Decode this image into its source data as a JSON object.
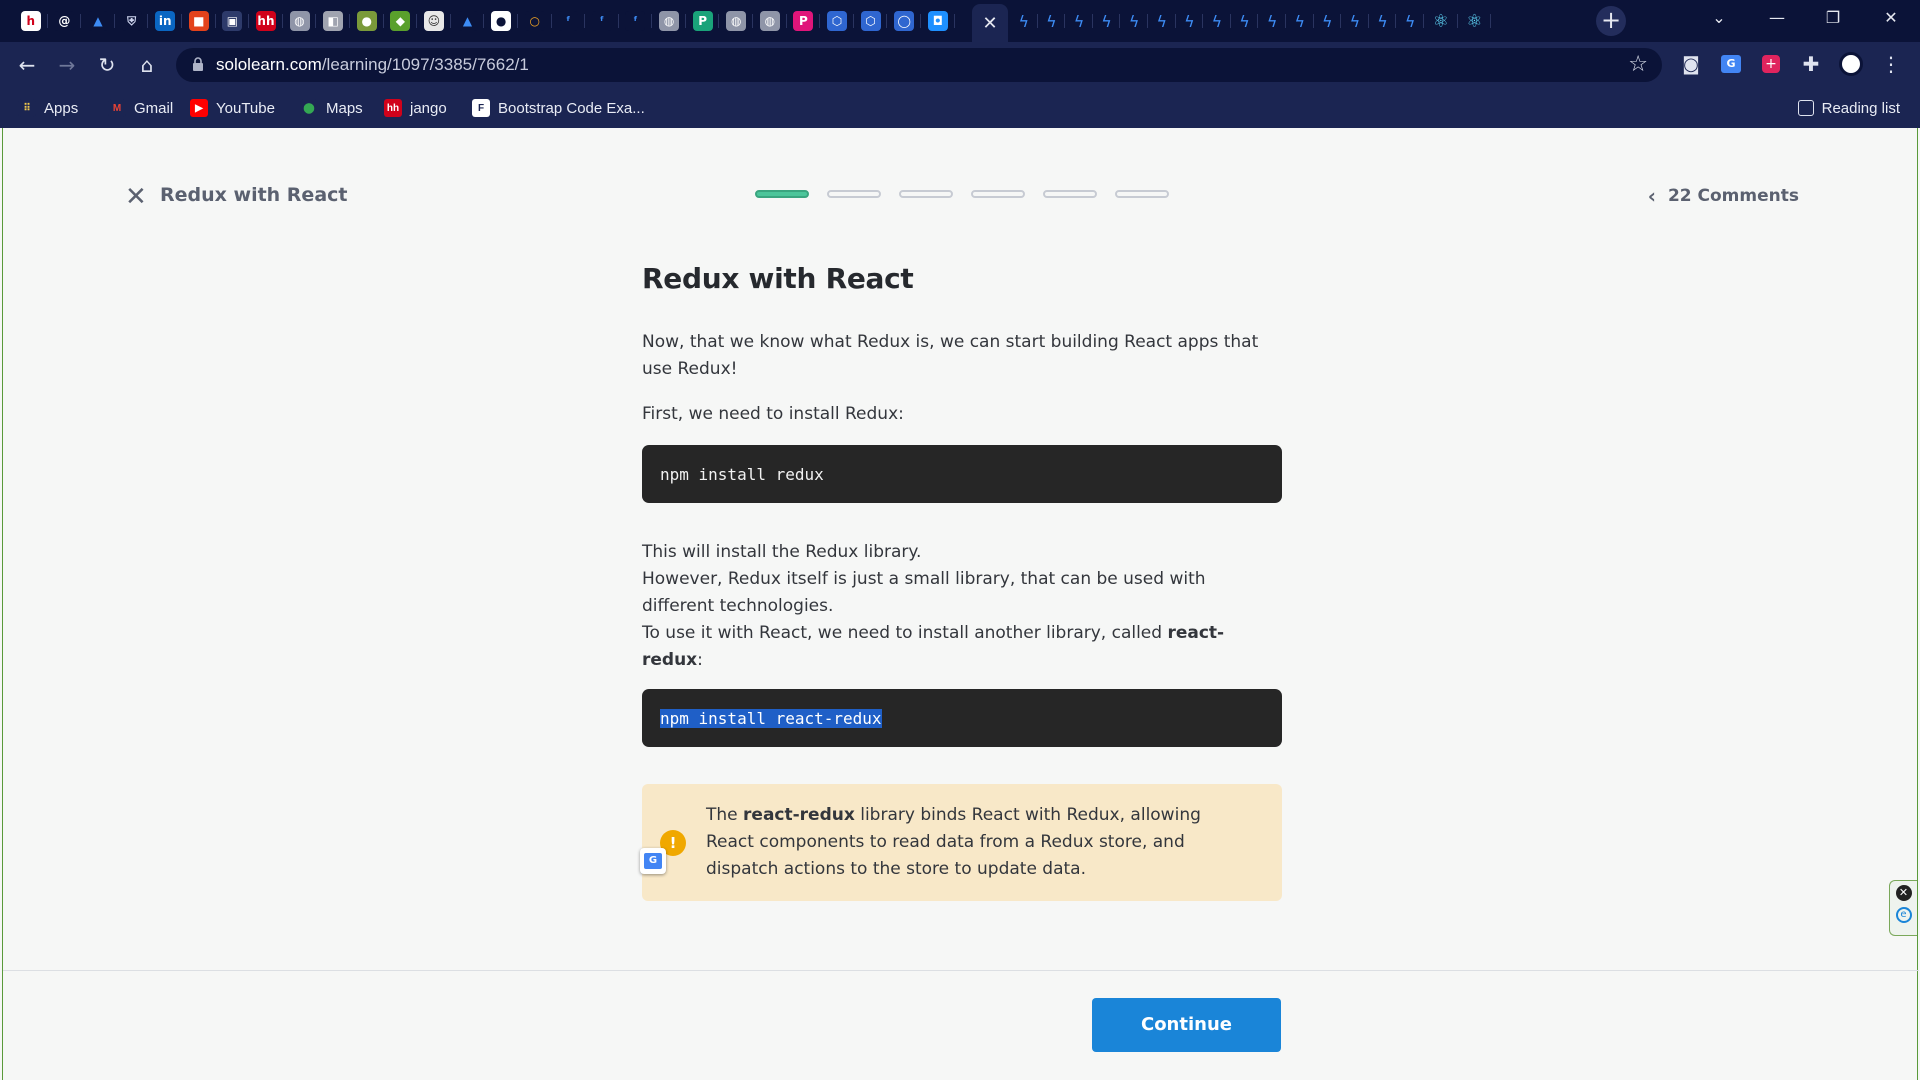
{
  "browser": {
    "tabs_left": [
      {
        "icon": "hh-icon",
        "bg": "#ffffff",
        "fg": "#d0021b",
        "txt": "h"
      },
      {
        "icon": "at-icon",
        "bg": "#0b1338",
        "fg": "#ffffff",
        "txt": "@"
      },
      {
        "icon": "triangle-icon",
        "bg": "#0b1338",
        "fg": "#3d8cf5",
        "txt": "▲"
      },
      {
        "icon": "shield-icon",
        "bg": "#0b1338",
        "fg": "#cfd6f0",
        "txt": "⛨"
      },
      {
        "icon": "linkedin-icon",
        "bg": "#0a66c2",
        "fg": "#ffffff",
        "txt": "in"
      },
      {
        "icon": "office-icon",
        "bg": "#e3421b",
        "fg": "#ffffff",
        "txt": "■"
      },
      {
        "icon": "monitor-icon",
        "bg": "#2d3a6a",
        "fg": "#ffffff",
        "txt": "▣"
      },
      {
        "icon": "hh-red-icon",
        "bg": "#d0021b",
        "fg": "#ffffff",
        "txt": "hh"
      },
      {
        "icon": "globe-icon",
        "bg": "#8f95a8",
        "fg": "#ffffff",
        "txt": "◍"
      },
      {
        "icon": "gray-doc-icon",
        "bg": "#a0a4b0",
        "fg": "#ffffff",
        "txt": "◧"
      },
      {
        "icon": "green-ball-icon",
        "bg": "#7a9a3a",
        "fg": "#ffffff",
        "txt": "●"
      },
      {
        "icon": "cube-icon",
        "bg": "#5aa02c",
        "fg": "#ffffff",
        "txt": "◆"
      },
      {
        "icon": "avatar-tab-icon",
        "bg": "#e8e8e8",
        "fg": "#333333",
        "txt": "☺"
      },
      {
        "icon": "atlassian-icon",
        "bg": "#0b1338",
        "fg": "#3d8cf5",
        "txt": "▲"
      },
      {
        "icon": "github-icon",
        "bg": "#ffffff",
        "fg": "#0b1338",
        "txt": "●"
      },
      {
        "icon": "ring-icon",
        "bg": "#0b1338",
        "fg": "#f5a623",
        "txt": "○"
      },
      {
        "icon": "bolt-tab-icon",
        "bg": "#0b1338",
        "fg": "#3d8cf5",
        "txt": "ᶠ"
      },
      {
        "icon": "bolt-tab-icon",
        "bg": "#0b1338",
        "fg": "#3d8cf5",
        "txt": "ᶠ"
      },
      {
        "icon": "bolt-tab-icon",
        "bg": "#0b1338",
        "fg": "#3d8cf5",
        "txt": "ᶠ"
      },
      {
        "icon": "globe-icon",
        "bg": "#8f95a8",
        "fg": "#ffffff",
        "txt": "◍"
      },
      {
        "icon": "p-green-icon",
        "bg": "#1aa37a",
        "fg": "#ffffff",
        "txt": "P"
      },
      {
        "icon": "globe-icon",
        "bg": "#8f95a8",
        "fg": "#ffffff",
        "txt": "◍"
      },
      {
        "icon": "globe-icon",
        "bg": "#8f95a8",
        "fg": "#ffffff",
        "txt": "◍"
      },
      {
        "icon": "p-pink-icon",
        "bg": "#e0157a",
        "fg": "#ffffff",
        "txt": "P"
      },
      {
        "icon": "hex-icon",
        "bg": "#2f66d0",
        "fg": "#ffffff",
        "txt": "⬡"
      },
      {
        "icon": "hex-icon",
        "bg": "#2f66d0",
        "fg": "#ffffff",
        "txt": "⬡"
      },
      {
        "icon": "circle-blue-icon",
        "bg": "#2f66d0",
        "fg": "#ffffff",
        "txt": "◯"
      },
      {
        "icon": "sololearn-icon",
        "bg": "#1e90ff",
        "fg": "#ffffff",
        "txt": "◘"
      }
    ],
    "active_tab_close": "✕",
    "tabs_right_count_bolts": 15,
    "tabs_right_react": 2,
    "url_host": "sololearn.com",
    "url_path": "/learning/1097/3385/7662/1",
    "bookmarks": [
      {
        "label": "Apps",
        "icon": "apps-grid-icon",
        "bg": "#1b2552",
        "fg": "#f2c94c",
        "txt": "⠿"
      },
      {
        "label": "Gmail",
        "icon": "gmail-icon",
        "bg": "#1b2552",
        "fg": "#ea4335",
        "txt": "M"
      },
      {
        "label": "YouTube",
        "icon": "youtube-icon",
        "bg": "#ff0000",
        "fg": "#ffffff",
        "txt": "▶"
      },
      {
        "label": "Maps",
        "icon": "maps-pin-icon",
        "bg": "#1b2552",
        "fg": "#34a853",
        "txt": "⬤"
      },
      {
        "label": "jango",
        "icon": "hh-red-icon",
        "bg": "#d0021b",
        "fg": "#ffffff",
        "txt": "hh"
      },
      {
        "label": "Bootstrap Code Exa...",
        "icon": "bootstrap-icon",
        "bg": "#ffffff",
        "fg": "#1b2552",
        "txt": "F"
      }
    ],
    "reading_list": "Reading list"
  },
  "lesson": {
    "header_title": "Redux with React",
    "progress_segments": 6,
    "progress_active_index": 0,
    "comments": "22 Comments",
    "heading": "Redux with React",
    "p1": "Now, that we know what Redux is, we can start building React apps that use Redux!",
    "p2": "First, we need to install Redux:",
    "code1": "npm install redux",
    "p3a": "This will install the Redux library.",
    "p3b": "However, Redux itself is just a small library, that can be used with different technologies.",
    "p3c_prefix": "To use it with React, we need to install another library, called ",
    "p3c_bold": "react-redux",
    "p3c_suffix": ":",
    "code2": "npm install react-redux",
    "note_prefix": "The ",
    "note_bold": "react-redux",
    "note_suffix": " library binds React with Redux, allowing React components to read data from a Redux store, and dispatch actions to the store to update data.",
    "continue_label": "Continue"
  }
}
